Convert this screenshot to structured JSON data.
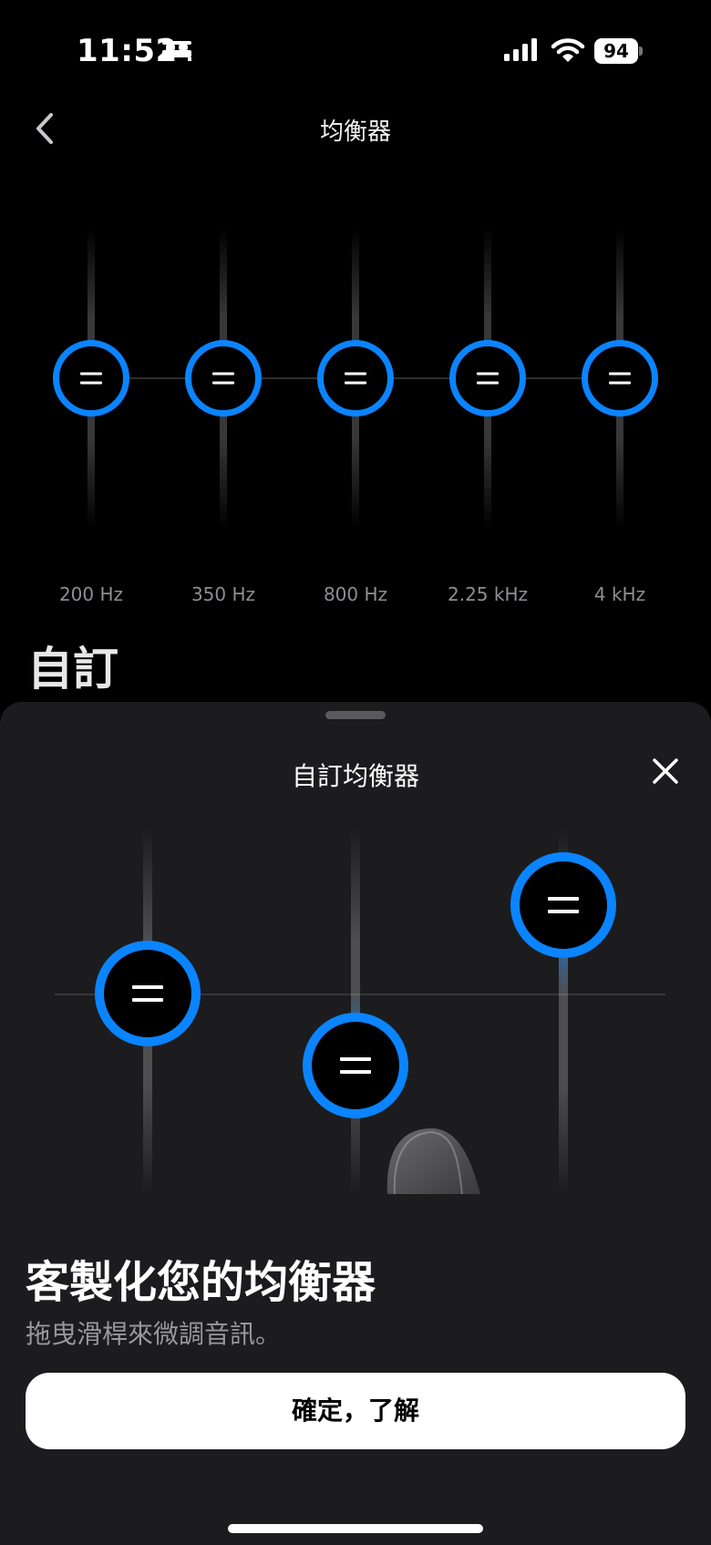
{
  "status_bar": {
    "time": "11:52",
    "battery": "94"
  },
  "header": {
    "title": "均衡器"
  },
  "equalizer": {
    "bands": [
      {
        "label": "200 Hz",
        "gain_level": 0.5
      },
      {
        "label": "350 Hz",
        "gain_level": 0.5
      },
      {
        "label": "800 Hz",
        "gain_level": 0.5
      },
      {
        "label": "2.25 kHz",
        "gain_level": 0.5
      },
      {
        "label": "4 kHz",
        "gain_level": 0.5
      }
    ]
  },
  "preset": {
    "name": "自訂"
  },
  "sheet": {
    "title": "自訂均衡器",
    "headline": "客製化您的均衡器",
    "description": "拖曳滑桿來微調音訊。",
    "confirm_label": "確定，了解",
    "illustration_levels": [
      0.5,
      0.28,
      0.77
    ]
  },
  "colors": {
    "accent": "#0a84ff",
    "background": "#000000",
    "sheet": "#1c1c1e",
    "secondary_text": "#8e8e93"
  }
}
